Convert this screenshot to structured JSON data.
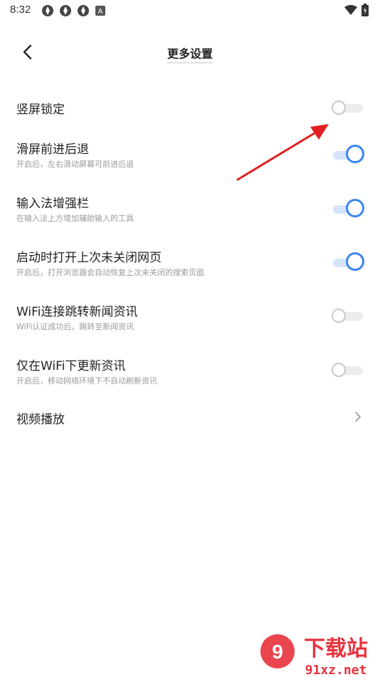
{
  "status_bar": {
    "time": "8:32",
    "notification_icons": [
      "app-icon",
      "app-icon",
      "app-icon",
      "a-badge-icon"
    ],
    "system_icons": [
      "wifi-icon",
      "battery-icon"
    ]
  },
  "header": {
    "title": "更多设置",
    "back_icon": "chevron-left-icon"
  },
  "settings": [
    {
      "label": "竖屏锁定",
      "sub": "",
      "control": "toggle",
      "on": false
    },
    {
      "label": "滑屏前进后退",
      "sub": "开启后，左右滑动屏幕可前进后退",
      "control": "toggle",
      "on": true
    },
    {
      "label": "输入法增强栏",
      "sub": "在输入法上方增加辅助输入的工具",
      "control": "toggle",
      "on": true
    },
    {
      "label": "启动时打开上次未关闭网页",
      "sub": "开启后，打开浏览器会自动恢复上次未关闭的搜索页面",
      "control": "toggle",
      "on": true
    },
    {
      "label": "WiFi连接跳转新闻资讯",
      "sub": "WiFi认证成功后，跳转至新闻资讯",
      "control": "toggle",
      "on": false
    },
    {
      "label": "仅在WiFi下更新资讯",
      "sub": "开启后，移动网络环境下不自动刷新资讯",
      "control": "toggle",
      "on": false
    },
    {
      "label": "视频播放",
      "sub": "",
      "control": "chevron",
      "on": null
    }
  ],
  "colors": {
    "toggle_on": "#3a86f0",
    "toggle_on_track": "#d6e4fb",
    "toggle_off": "#c9c9c9",
    "annotation_arrow": "#e02020",
    "watermark_red": "#e8323c"
  },
  "watermark": {
    "brand_text": "下载站",
    "domain": "91xz.net"
  }
}
